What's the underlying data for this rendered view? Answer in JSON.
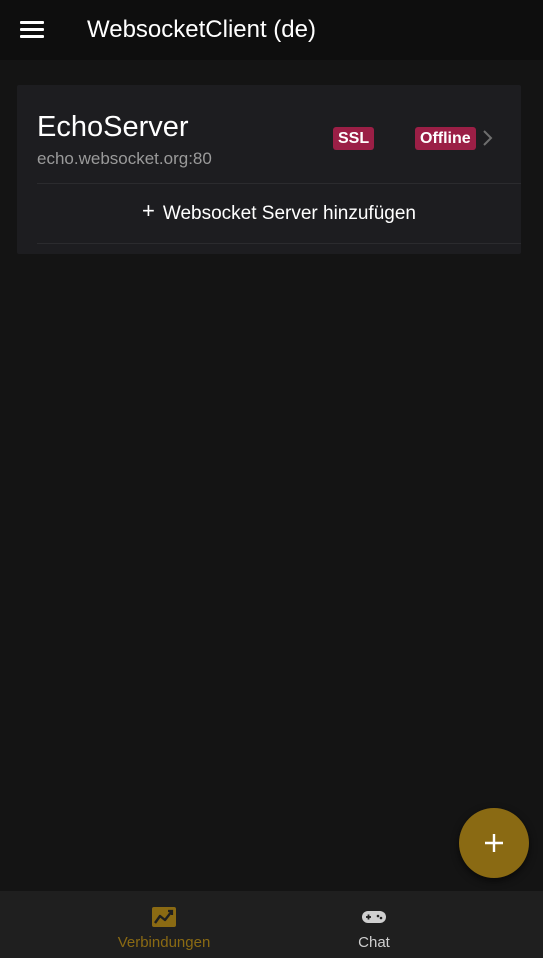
{
  "header": {
    "title": "WebsocketClient (de)",
    "menu_icon": "hamburger-menu-icon"
  },
  "servers": [
    {
      "name": "EchoServer",
      "address": "echo.websocket.org:80",
      "ssl_badge": "SSL",
      "status_badge": "Offline",
      "badge_color": "#9b1f46"
    }
  ],
  "add_server": {
    "icon": "plus-icon",
    "label": "Websocket Server hinzufügen"
  },
  "fab": {
    "icon": "plus-icon",
    "color": "#8a6a13"
  },
  "bottom_nav": {
    "active_color": "#8a6a13",
    "tabs": [
      {
        "label": "Verbindungen",
        "icon": "chart-line-icon",
        "active": true
      },
      {
        "label": "Chat",
        "icon": "gamepad-icon",
        "active": false
      }
    ]
  }
}
